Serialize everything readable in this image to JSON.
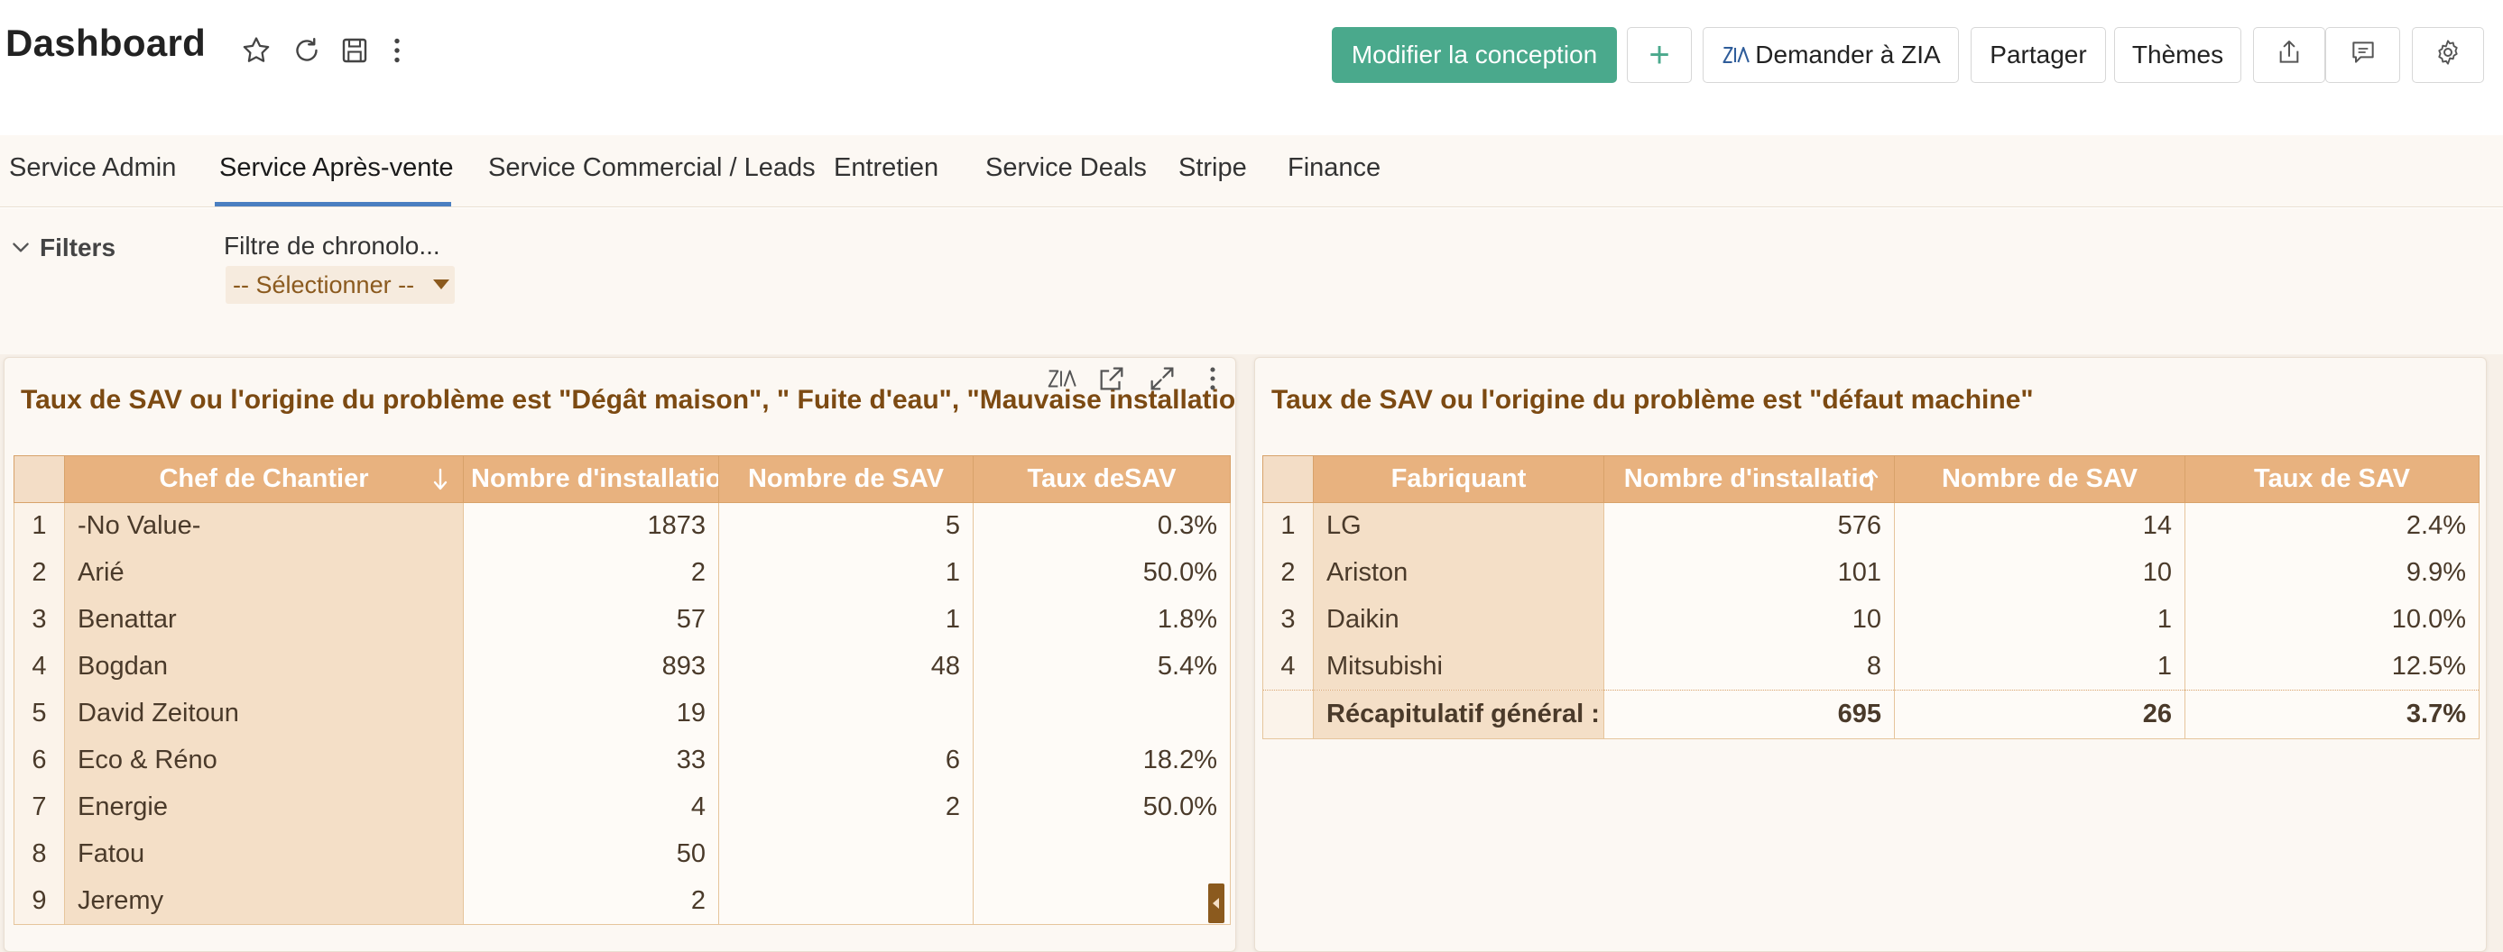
{
  "header": {
    "title": "Dashboard",
    "buttons": {
      "edit_design": "Modifier la conception",
      "add": "+",
      "ask_zia": "Demander à ZIA",
      "share": "Partager",
      "themes": "Thèmes"
    },
    "icons": [
      "star-icon",
      "refresh-icon",
      "save-icon",
      "more-vertical-icon",
      "export-icon",
      "comment-icon",
      "settings-icon"
    ],
    "accent_color": "#4aa98c"
  },
  "tabs": [
    {
      "label": "Service Admin",
      "active": false
    },
    {
      "label": "Service Après-vente",
      "active": true
    },
    {
      "label": "Service Commercial / Leads",
      "active": false
    },
    {
      "label": "Entretien",
      "active": false
    },
    {
      "label": "Service Deals",
      "active": false
    },
    {
      "label": "Stripe",
      "active": false
    },
    {
      "label": "Finance",
      "active": false
    }
  ],
  "filters": {
    "toggle_label": "Filters",
    "timeline_filter_label": "Filtre de chronolo...",
    "timeline_filter_value": "-- Sélectionner --"
  },
  "widget1": {
    "title": "Taux de SAV ou l'origine du problème est \"Dégât maison\", \" Fuite d'eau\", \"Mauvaise installation\"",
    "columns": [
      "Chef de Chantier",
      "Nombre d'installatio",
      "Nombre de SAV",
      "Taux deSAV"
    ],
    "rows": [
      {
        "idx": "1",
        "name": "-No Value-",
        "installs": "1873",
        "sav": "5",
        "rate": "0.3%"
      },
      {
        "idx": "2",
        "name": "Arié",
        "installs": "2",
        "sav": "1",
        "rate": "50.0%"
      },
      {
        "idx": "3",
        "name": "Benattar",
        "installs": "57",
        "sav": "1",
        "rate": "1.8%"
      },
      {
        "idx": "4",
        "name": "Bogdan",
        "installs": "893",
        "sav": "48",
        "rate": "5.4%"
      },
      {
        "idx": "5",
        "name": "David Zeitoun",
        "installs": "19",
        "sav": "",
        "rate": ""
      },
      {
        "idx": "6",
        "name": "Eco & Réno",
        "installs": "33",
        "sav": "6",
        "rate": "18.2%"
      },
      {
        "idx": "7",
        "name": "Energie",
        "installs": "4",
        "sav": "2",
        "rate": "50.0%"
      },
      {
        "idx": "8",
        "name": "Fatou",
        "installs": "50",
        "sav": "",
        "rate": ""
      },
      {
        "idx": "9",
        "name": "Jeremy",
        "installs": "2",
        "sav": "",
        "rate": ""
      }
    ]
  },
  "widget2": {
    "title": "Taux de SAV ou l'origine du problème est \"défaut machine\"",
    "columns": [
      "Fabriquant",
      "Nombre d'installatio",
      "Nombre de SAV",
      "Taux de SAV"
    ],
    "rows": [
      {
        "idx": "1",
        "name": "LG",
        "installs": "576",
        "sav": "14",
        "rate": "2.4%"
      },
      {
        "idx": "2",
        "name": "Ariston",
        "installs": "101",
        "sav": "10",
        "rate": "9.9%"
      },
      {
        "idx": "3",
        "name": "Daikin",
        "installs": "10",
        "sav": "1",
        "rate": "10.0%"
      },
      {
        "idx": "4",
        "name": "Mitsubishi",
        "installs": "8",
        "sav": "1",
        "rate": "12.5%"
      }
    ],
    "total": {
      "label": "Récapitulatif général :",
      "installs": "695",
      "sav": "26",
      "rate": "3.7%"
    }
  }
}
